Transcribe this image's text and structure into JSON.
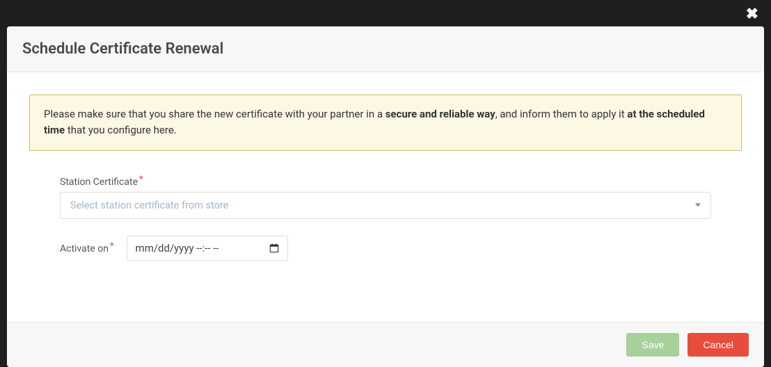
{
  "modal": {
    "title": "Schedule Certificate Renewal",
    "close_icon": "✖",
    "alert": {
      "t1": "Please make sure that you share the new certificate with your partner in a ",
      "b1": "secure and reliable way",
      "t2": ", and inform them to apply it ",
      "b2": "at the scheduled time",
      "t3": " that you configure here."
    },
    "fields": {
      "station_cert": {
        "label": "Station Certificate",
        "required_mark": "*",
        "placeholder": "Select station certificate from store"
      },
      "activate_on": {
        "label": "Activate on",
        "required_mark": "*",
        "placeholder": "mm/dd/yyyy --:-- --"
      }
    },
    "footer": {
      "save": "Save",
      "cancel": "Cancel"
    }
  }
}
